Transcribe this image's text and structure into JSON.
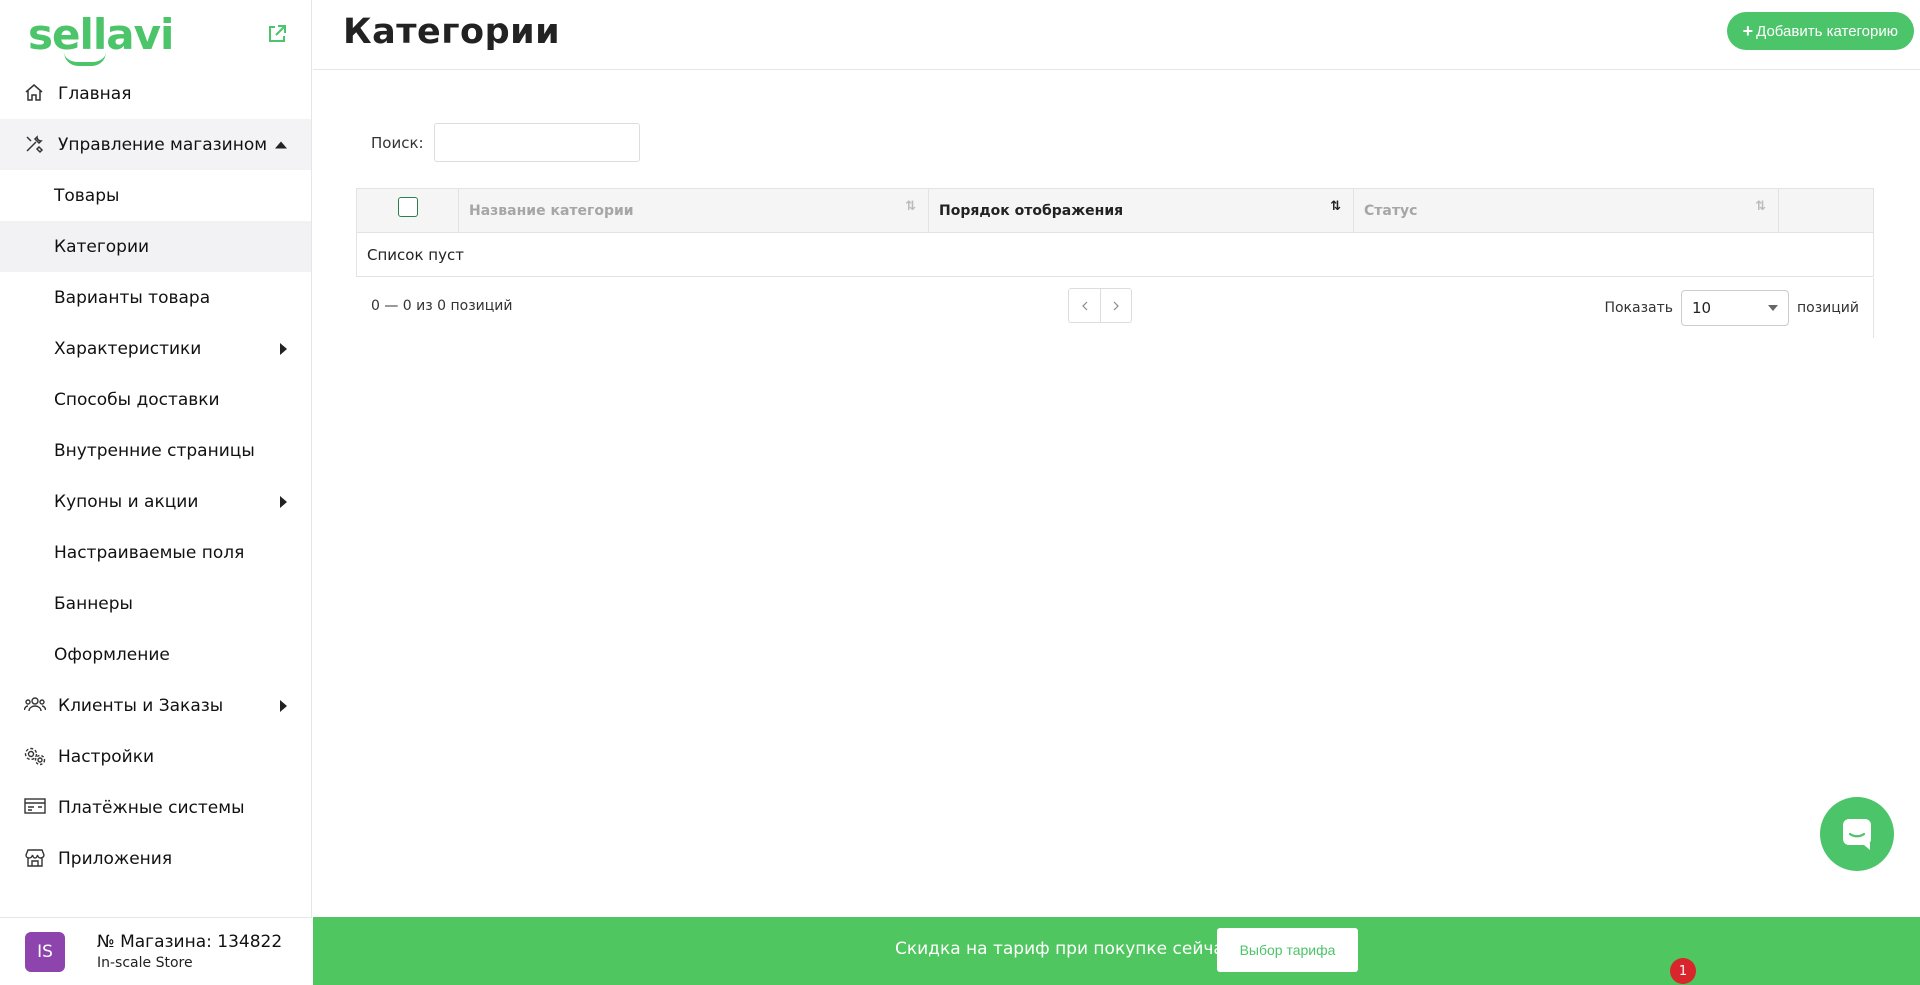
{
  "brand": {
    "logo_text": "sellavi",
    "accent_color": "#4bc46a"
  },
  "sidebar": {
    "items": [
      {
        "label": "Главная",
        "icon": "home-icon"
      },
      {
        "label": "Управление магазином",
        "icon": "tools-icon",
        "expanded": true
      },
      {
        "label": "Товары"
      },
      {
        "label": "Категории",
        "active": true
      },
      {
        "label": "Варианты товара"
      },
      {
        "label": "Характеристики",
        "has_submenu": true
      },
      {
        "label": "Способы доставки"
      },
      {
        "label": "Внутренние страницы"
      },
      {
        "label": "Купоны и акции",
        "has_submenu": true
      },
      {
        "label": "Настраиваемые поля"
      },
      {
        "label": "Баннеры"
      },
      {
        "label": "Оформление"
      },
      {
        "label": "Клиенты и Заказы",
        "icon": "users-icon",
        "has_submenu": true
      },
      {
        "label": "Настройки",
        "icon": "settings-icon"
      },
      {
        "label": "Платёжные системы",
        "icon": "payment-icon"
      },
      {
        "label": "Приложения",
        "icon": "store-icon"
      }
    ]
  },
  "store": {
    "avatar": "IS",
    "avatar_color": "#8e44ad",
    "number": "№ Магазина: 134822",
    "name": "In-scale Store"
  },
  "header": {
    "title": "Категории",
    "add_button": "Добавить категорию",
    "add_plus": "+"
  },
  "search": {
    "label": "Поиск:",
    "value": "",
    "placeholder": ""
  },
  "table": {
    "columns": [
      "Название категории",
      "Порядок отображения",
      "Статус"
    ],
    "empty_text": "Список пуст"
  },
  "pagination": {
    "info": "0 — 0 из 0 позиций",
    "show_label": "Показать",
    "page_size": "10",
    "items_label": "позиций"
  },
  "promo": {
    "text": "Скидка на тариф при покупке сейчас",
    "button": "Выбор тарифа",
    "bg_color": "#4fc65f"
  },
  "notification": {
    "count": "1"
  }
}
